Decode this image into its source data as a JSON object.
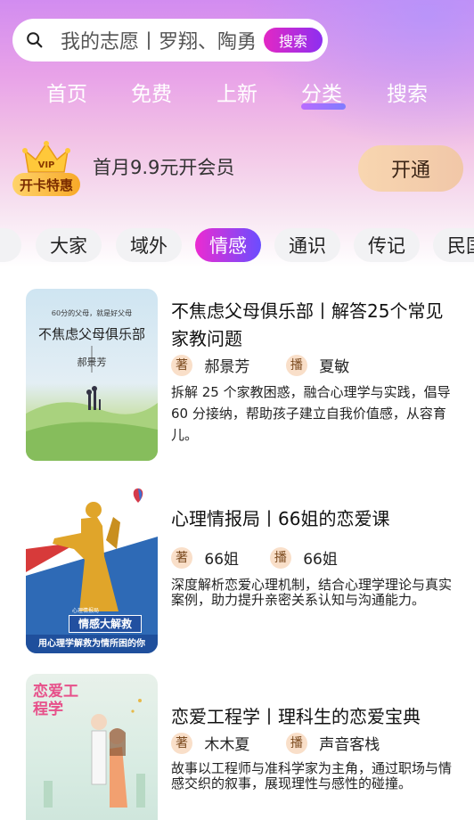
{
  "search": {
    "placeholder": "我的志愿丨罗翔、陶勇",
    "button": "搜索"
  },
  "nav": {
    "tabs": [
      {
        "label": "首页"
      },
      {
        "label": "免费"
      },
      {
        "label": "上新"
      },
      {
        "label": "分类",
        "active": true
      },
      {
        "label": "搜索"
      }
    ]
  },
  "vip": {
    "badge_top": "VIP",
    "badge": "开卡特惠",
    "text": "首月9.9元开会员",
    "button": "开通"
  },
  "categories": {
    "items": [
      {
        "label": "大家"
      },
      {
        "label": "域外"
      },
      {
        "label": "情感",
        "active": true
      },
      {
        "label": "通识"
      },
      {
        "label": "传记"
      },
      {
        "label": "民国"
      }
    ]
  },
  "books": [
    {
      "title": "不焦虑父母俱乐部丨解答25个常见家教问题",
      "author_badge": "著",
      "author": "郝景芳",
      "narrator_badge": "播",
      "narrator": "夏敏",
      "desc": "拆解 25 个家教困惑，融合心理学与实践，倡导 60 分接纳，帮助孩子建立自我价值感，从容育儿。",
      "cover": {
        "top": "60分的父母，就是好父母",
        "title": "不焦虑父母俱乐部",
        "author": "郝景芳"
      }
    },
    {
      "title": "心理情报局丨66姐的恋爱课",
      "author_badge": "著",
      "author": "66姐",
      "narrator_badge": "播",
      "narrator": "66姐",
      "desc": "深度解析恋爱心理机制，结合心理学理论与真实案例，助力提升亲密关系认知与沟通能力。",
      "cover": {
        "small": "心理情报局",
        "banner": "情感大解救",
        "strip": "用心理学解救为情所困的你"
      }
    },
    {
      "title": "恋爱工程学丨理科生的恋爱宝典",
      "author_badge": "著",
      "author": "木木夏",
      "narrator_badge": "播",
      "narrator": "声音客栈",
      "desc": "故事以工程师与准科学家为主角，通过职场与情感交织的叙事，展现理性与感性的碰撞。",
      "cover": {
        "title": "恋爱工程学"
      }
    }
  ],
  "colors": {
    "accent_from": "#ec2bd1",
    "accent_to": "#6a4dff",
    "vip_button": "#f8d6b0"
  }
}
